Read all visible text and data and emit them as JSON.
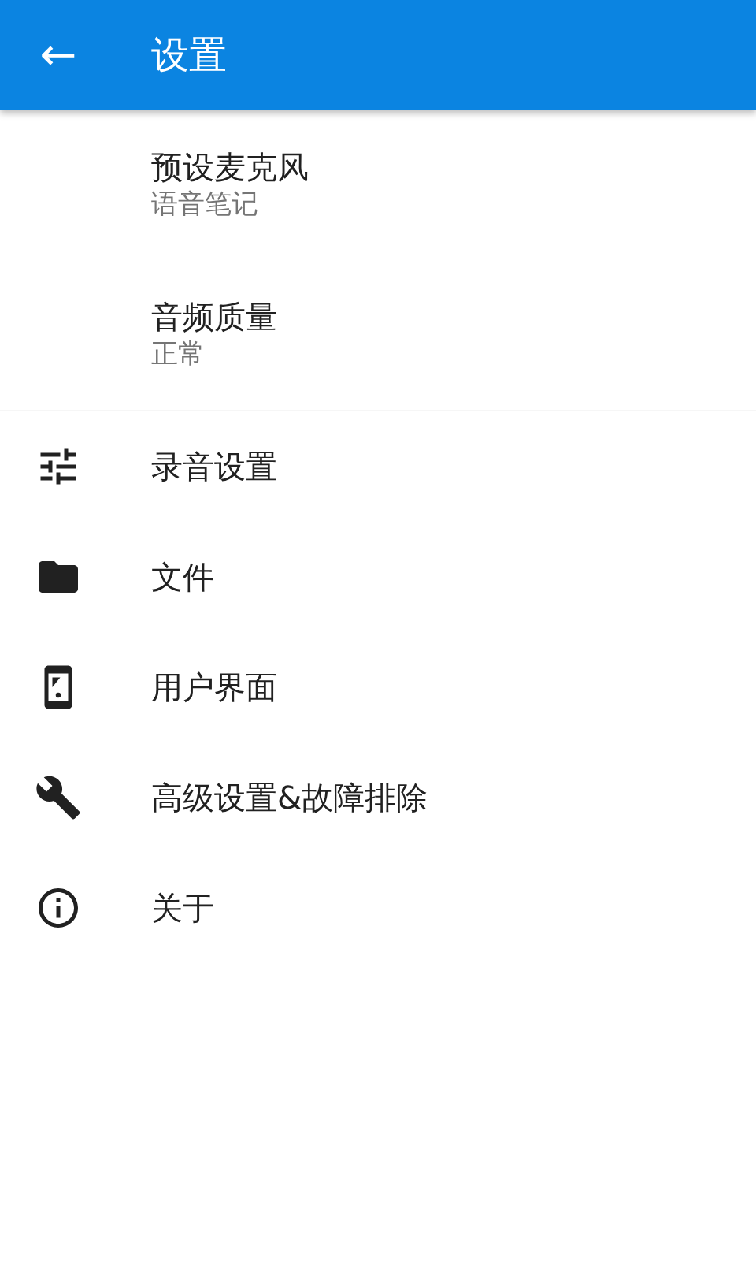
{
  "app_bar": {
    "back_icon": "←",
    "title": "设置"
  },
  "preferences": [
    {
      "title": "预设麦克风",
      "summary": "语音笔记"
    },
    {
      "title": "音频质量",
      "summary": "正常"
    }
  ],
  "menu": [
    {
      "kind": "tune",
      "label": "录音设置"
    },
    {
      "kind": "folder",
      "label": "文件"
    },
    {
      "kind": "phone",
      "label": "用户界面"
    },
    {
      "kind": "wrench",
      "label": "高级设置&故障排除"
    },
    {
      "kind": "info",
      "label": "关于"
    }
  ]
}
